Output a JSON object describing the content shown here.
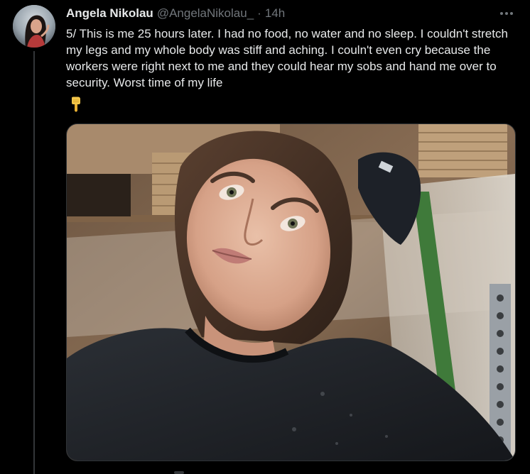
{
  "tweet": {
    "display_name": "Angela Nikolau",
    "handle": "@AngelaNikolau_",
    "separator": "·",
    "time": "14h",
    "text": "5/ This is me 25 hours later. I had no food, no water and no sleep. I couldn't stretch my legs and my whole body was stiff and aching. I couln't even cry because the workers were right next to me and they could hear my sobs and hand me over to security. Worst time of my life",
    "emoji": "backhand-index-pointing-down",
    "more_icon": "more-horizontal-icon"
  },
  "media": {
    "type": "photo"
  },
  "colors": {
    "background": "#000000",
    "primary_text": "#e7e9ea",
    "secondary_text": "#71767b",
    "border": "#2f3336",
    "thread_line": "#333639"
  }
}
